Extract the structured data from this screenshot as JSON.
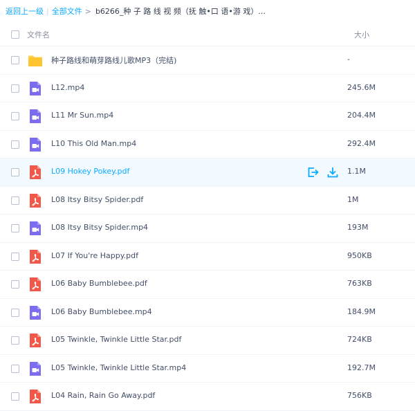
{
  "breadcrumb": {
    "back": "返回上一级",
    "separator": "|",
    "all_files": "全部文件",
    "arrow": ">",
    "current": "b6266_种 子 路 线 视 频（抚 触•口 语•游 戏）..."
  },
  "header": {
    "name": "文件名",
    "size": "大小"
  },
  "files": [
    {
      "name": "种子路线和萌芽路线儿歌MP3（完结)",
      "size": "-",
      "icon": "folder-icon"
    },
    {
      "name": "L12.mp4",
      "size": "245.6M",
      "icon": "video-file-icon"
    },
    {
      "name": "L11 Mr Sun.mp4",
      "size": "204.4M",
      "icon": "video-file-icon"
    },
    {
      "name": "L10 This Old Man.mp4",
      "size": "292.4M",
      "icon": "video-file-icon"
    },
    {
      "name": "L09 Hokey Pokey.pdf",
      "size": "1.1M",
      "icon": "pdf-file-icon"
    },
    {
      "name": "L08 Itsy Bitsy Spider.pdf",
      "size": "1M",
      "icon": "pdf-file-icon"
    },
    {
      "name": "L08 Itsy Bitsy Spider.mp4",
      "size": "193M",
      "icon": "video-file-icon"
    },
    {
      "name": "L07 If You're Happy.pdf",
      "size": "950KB",
      "icon": "pdf-file-icon"
    },
    {
      "name": "L06 Baby Bumblebee.pdf",
      "size": "763KB",
      "icon": "pdf-file-icon"
    },
    {
      "name": "L06 Baby Bumblebee.mp4",
      "size": "184.9M",
      "icon": "video-file-icon"
    },
    {
      "name": "L05 Twinkle, Twinkle Little Star.pdf",
      "size": "724KB",
      "icon": "pdf-file-icon"
    },
    {
      "name": "L05 Twinkle, Twinkle Little Star.mp4",
      "size": "192.7M",
      "icon": "video-file-icon"
    },
    {
      "name": "L04 Rain, Rain Go Away.pdf",
      "size": "756KB",
      "icon": "pdf-file-icon"
    }
  ],
  "hovered_row": 4,
  "row_actions": [
    "share-icon",
    "download-icon"
  ],
  "colors": {
    "accent": "#09aaff",
    "folder": "#ffd04c",
    "video": "#7c6df0",
    "pdf": "#f2584a"
  }
}
